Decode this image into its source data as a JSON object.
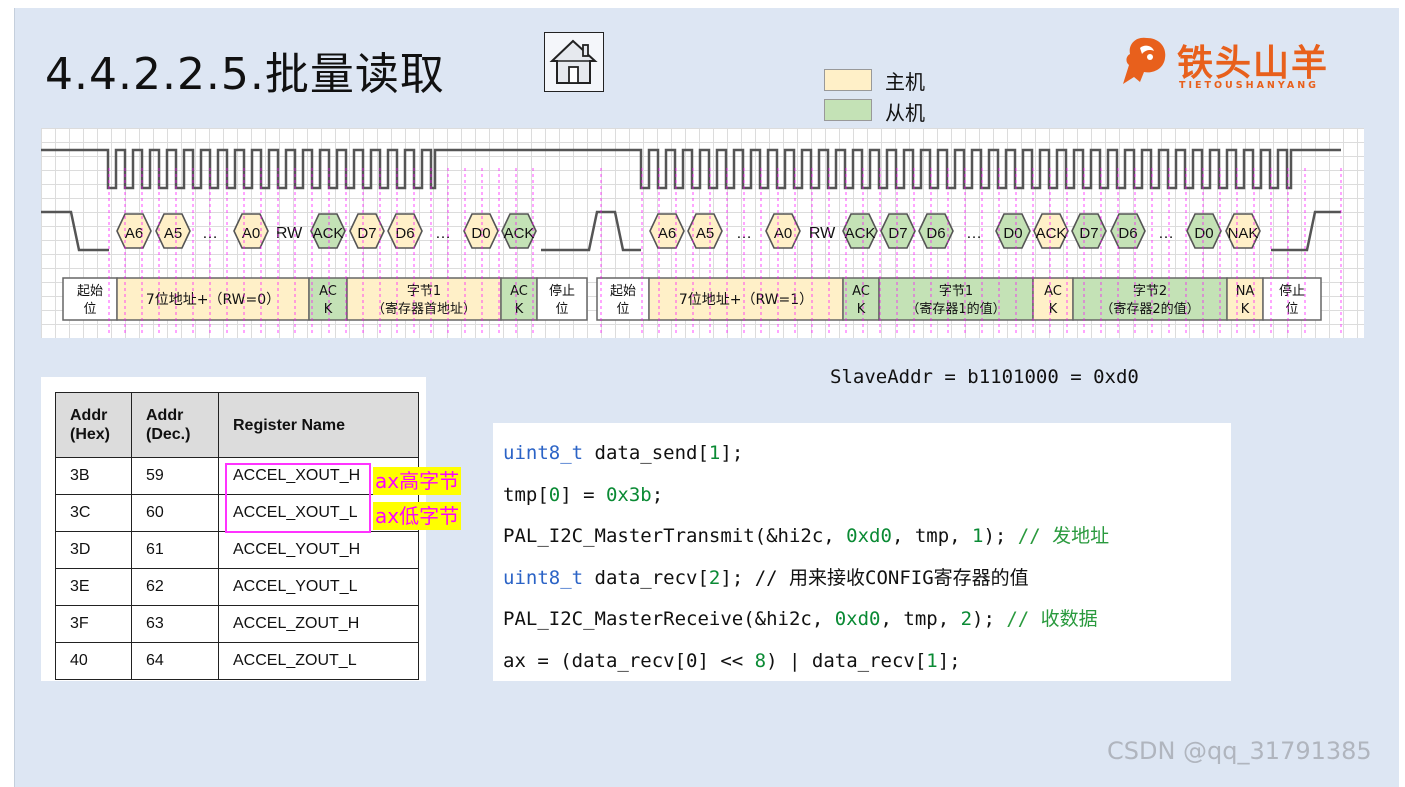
{
  "title": "4.4.2.2.5.批量读取",
  "legend": [
    {
      "label": "主机",
      "color": "#fff0c8"
    },
    {
      "label": "从机",
      "color": "#c4e2b6"
    }
  ],
  "logo": {
    "text": "铁头山羊",
    "subtitle": "TIETOUSHANYANG",
    "color": "#e8601c"
  },
  "timing": {
    "frame1": {
      "bits": [
        "A6",
        "A5",
        "…",
        "A0",
        "RW",
        "ACK",
        "D7",
        "D6",
        "…",
        "D0",
        "ACK"
      ],
      "fields": [
        {
          "line1": "起始",
          "line2": "位"
        },
        {
          "line1": "7位地址+（RW=0）",
          "line2": ""
        },
        {
          "line1": "AC",
          "line2": "K"
        },
        {
          "line1": "字节1",
          "line2": "（寄存器首地址）"
        },
        {
          "line1": "AC",
          "line2": "K"
        },
        {
          "line1": "停止",
          "line2": "位"
        }
      ]
    },
    "frame2": {
      "bits": [
        "A6",
        "A5",
        "…",
        "A0",
        "RW",
        "ACK",
        "D7",
        "D6",
        "…",
        "D0",
        "ACK",
        "D7",
        "D6",
        "…",
        "D0",
        "NAK"
      ],
      "fields": [
        {
          "line1": "起始",
          "line2": "位"
        },
        {
          "line1": "7位地址+（RW=1）",
          "line2": ""
        },
        {
          "line1": "AC",
          "line2": "K"
        },
        {
          "line1": "字节1",
          "line2": "（寄存器1的值）"
        },
        {
          "line1": "AC",
          "line2": "K"
        },
        {
          "line1": "字节2",
          "line2": "（寄存器2的值）"
        },
        {
          "line1": "NA",
          "line2": "K"
        },
        {
          "line1": "停止",
          "line2": "位"
        }
      ]
    }
  },
  "slave_addr": "SlaveAddr = b1101000 = 0xd0",
  "register_table": {
    "headers": [
      "Addr\n(Hex)",
      "Addr\n(Dec.)",
      "Register Name"
    ],
    "rows": [
      [
        "3B",
        "59",
        "ACCEL_XOUT_H"
      ],
      [
        "3C",
        "60",
        "ACCEL_XOUT_L"
      ],
      [
        "3D",
        "61",
        "ACCEL_YOUT_H"
      ],
      [
        "3E",
        "62",
        "ACCEL_YOUT_L"
      ],
      [
        "3F",
        "63",
        "ACCEL_ZOUT_H"
      ],
      [
        "40",
        "64",
        "ACCEL_ZOUT_L"
      ]
    ],
    "annotations": [
      "ax高字节",
      "ax低字节"
    ]
  },
  "code": [
    [
      {
        "t": "uint8_t",
        "c": "kw"
      },
      {
        "t": " data_send["
      },
      {
        "t": "1",
        "c": "num"
      },
      {
        "t": "];"
      }
    ],
    [
      {
        "t": "tmp["
      },
      {
        "t": "0",
        "c": "num"
      },
      {
        "t": "] = "
      },
      {
        "t": "0x3b",
        "c": "num"
      },
      {
        "t": ";"
      }
    ],
    [
      {
        "t": "PAL_I2C_MasterTransmit(&hi2c, "
      },
      {
        "t": "0xd0",
        "c": "num"
      },
      {
        "t": ", tmp, "
      },
      {
        "t": "1",
        "c": "num"
      },
      {
        "t": "); "
      },
      {
        "t": "// 发地址",
        "c": "cmt"
      }
    ],
    [
      {
        "t": "uint8_t",
        "c": "kw"
      },
      {
        "t": " data_recv["
      },
      {
        "t": "2",
        "c": "num"
      },
      {
        "t": "]; // 用来接收CONFIG寄存器的值"
      }
    ],
    [
      {
        "t": "PAL_I2C_MasterReceive(&hi2c, "
      },
      {
        "t": "0xd0",
        "c": "num"
      },
      {
        "t": ", tmp, "
      },
      {
        "t": "2",
        "c": "num"
      },
      {
        "t": "); "
      },
      {
        "t": "// 收数据",
        "c": "cmt"
      }
    ],
    [
      {
        "t": "ax = (data_recv[0] << "
      },
      {
        "t": "8",
        "c": "num"
      },
      {
        "t": ") | data_recv["
      },
      {
        "t": "1",
        "c": "num"
      },
      {
        "t": "];"
      }
    ]
  ],
  "watermark": "CSDN @qq_31791385"
}
